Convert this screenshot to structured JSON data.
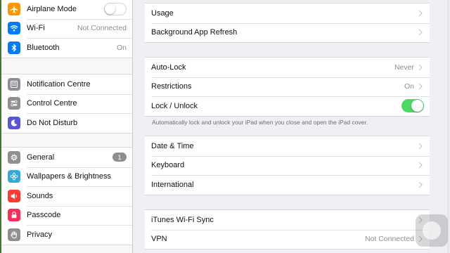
{
  "sidebar": {
    "groups": [
      [
        {
          "label": "Airplane Mode",
          "icon": "airplane-icon",
          "color": "#ff9500",
          "control": "toggle-off"
        },
        {
          "label": "Wi-Fi",
          "icon": "wifi-icon",
          "color": "#007aff",
          "value": "Not Connected"
        },
        {
          "label": "Bluetooth",
          "icon": "bluetooth-icon",
          "color": "#007aff",
          "value": "On"
        }
      ],
      [
        {
          "label": "Notification Centre",
          "icon": "notification-centre-icon",
          "color": "#8e8e93"
        },
        {
          "label": "Control Centre",
          "icon": "control-centre-icon",
          "color": "#8e8e93"
        },
        {
          "label": "Do Not Disturb",
          "icon": "moon-icon",
          "color": "#5856d6"
        }
      ],
      [
        {
          "label": "General",
          "icon": "gear-icon",
          "color": "#8e8e93",
          "badge": "1"
        },
        {
          "label": "Wallpapers & Brightness",
          "icon": "flower-icon",
          "color": "#34aadc"
        },
        {
          "label": "Sounds",
          "icon": "speaker-icon",
          "color": "#ff3b30"
        },
        {
          "label": "Passcode",
          "icon": "lock-icon",
          "color": "#ff2d55"
        },
        {
          "label": "Privacy",
          "icon": "hand-icon",
          "color": "#8e8e93"
        }
      ]
    ]
  },
  "main": {
    "groups": [
      [
        {
          "label": "Usage"
        },
        {
          "label": "Background App Refresh"
        }
      ],
      [
        {
          "label": "Auto-Lock",
          "value": "Never"
        },
        {
          "label": "Restrictions",
          "value": "On"
        },
        {
          "label": "Lock / Unlock",
          "control": "toggle-on"
        }
      ],
      [
        {
          "label": "Date & Time"
        },
        {
          "label": "Keyboard"
        },
        {
          "label": "International"
        }
      ],
      [
        {
          "label": "iTunes Wi-Fi Sync"
        },
        {
          "label": "VPN",
          "value": "Not Connected"
        }
      ]
    ],
    "footnote": "Automatically lock and unlock your iPad when you close and open the iPad cover."
  },
  "colors": {
    "toggle_on": "#4cd964",
    "badge": "#8e8e93"
  }
}
